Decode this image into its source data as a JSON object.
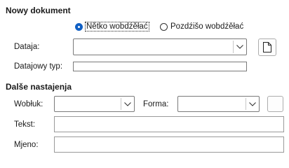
{
  "new_document": {
    "heading": "Nowy dokument",
    "radio_now": {
      "label": "Nětko wobdźěłać",
      "checked": true
    },
    "radio_later": {
      "label": "Pozdźišo wobdźěłać",
      "checked": false
    },
    "file_label": "Dataja:",
    "file_value": "",
    "file_type_label": "Datajowy typ:",
    "file_type_value": "",
    "browse_icon": "document-icon"
  },
  "more_settings": {
    "heading": "Dalše nastajenja",
    "frame_label": "Wobłuk:",
    "frame_value": "",
    "form_label": "Forma:",
    "form_value": "",
    "text_label": "Tekst:",
    "text_value": "",
    "name_label": "Mjeno:",
    "name_value": ""
  }
}
